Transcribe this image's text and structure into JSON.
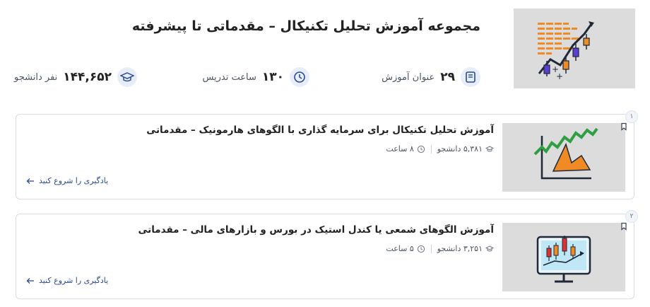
{
  "header": {
    "title": "مجموعه آموزش تحلیل تکنیکال – مقدماتی تا پیشرفته",
    "thumbnail_icon": "candlestick-bars-chart"
  },
  "stats": [
    {
      "icon": "book-icon",
      "value": "۲۹",
      "label": "عنوان آموزش"
    },
    {
      "icon": "clock-icon",
      "value": "۱۳۰",
      "label": "ساعت تدریس"
    },
    {
      "icon": "graduation-cap-icon",
      "value": "۱۴۴,۶۵۲",
      "label": "نفر دانشجو"
    }
  ],
  "courses": [
    {
      "index": "۱",
      "title": "آموزش تحلیل تکنیکال برای سرمایه گذاری با الگوهای هارمونیک – مقدماتی",
      "students": "۵,۳۸۱ دانشجو",
      "duration": "۸ ساعت",
      "cta": "یادگیری را شروع کنید",
      "thumbnail_icon": "harmonic-pattern-chart"
    },
    {
      "index": "۲",
      "title": "آموزش الگوهای شمعی یا کندل استیک در بورس و بازارهای مالی – مقدماتی",
      "students": "۳,۲۵۱ دانشجو",
      "duration": "۵ ساعت",
      "cta": "یادگیری را شروع کنید",
      "thumbnail_icon": "monitor-candlestick-chart"
    }
  ],
  "colors": {
    "accent_blue": "#2b4a8f",
    "icon_circle_bg": "#e8eef9",
    "thumb_bg": "#dcdcdc",
    "orange": "#f08a24",
    "green": "#2f9e44",
    "purple": "#5b3fd1"
  }
}
